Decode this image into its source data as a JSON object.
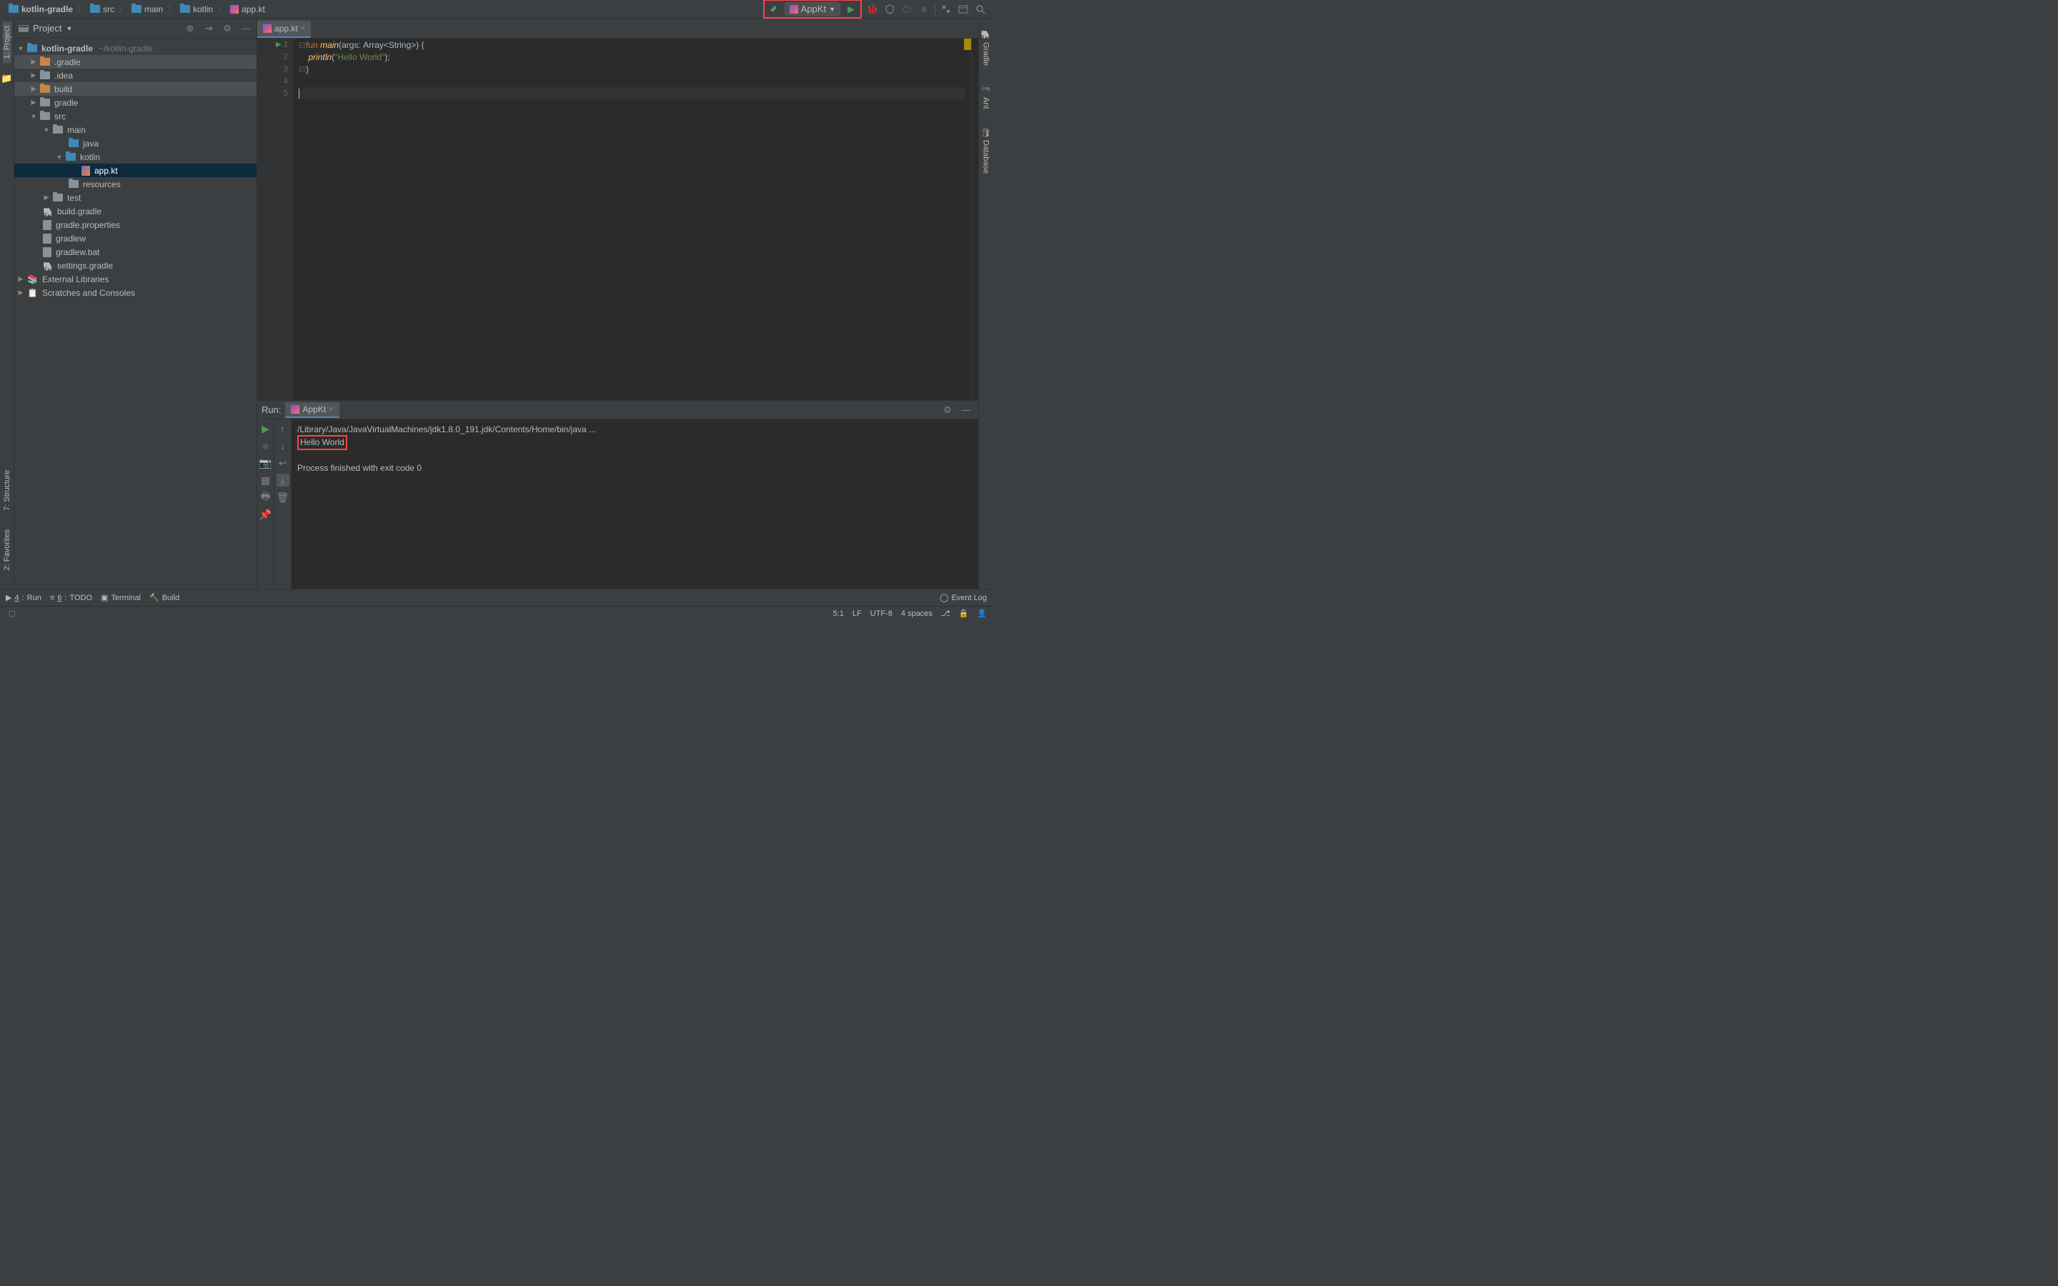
{
  "breadcrumb": {
    "items": [
      {
        "label": "kotlin-gradle",
        "icon": "folder-blue"
      },
      {
        "label": "src",
        "icon": "folder-blue"
      },
      {
        "label": "main",
        "icon": "folder-blue"
      },
      {
        "label": "kotlin",
        "icon": "folder-blue"
      },
      {
        "label": "app.kt",
        "icon": "kotlin"
      }
    ]
  },
  "run_config": {
    "label": "AppKt"
  },
  "sidebar": {
    "title": "Project",
    "root": {
      "label": "kotlin-gradle",
      "path": "~/kotlin-gradle"
    },
    "tree": {
      "gradle_dir": ".gradle",
      "idea_dir": ".idea",
      "build": "build",
      "gradle": "gradle",
      "src": "src",
      "main": "main",
      "java": "java",
      "kotlin": "kotlin",
      "app_kt": "app.kt",
      "resources": "resources",
      "test": "test",
      "build_gradle": "build.gradle",
      "gradle_properties": "gradle.properties",
      "gradlew": "gradlew",
      "gradlew_bat": "gradlew.bat",
      "settings_gradle": "settings.gradle",
      "external_libs": "External Libraries",
      "scratches": "Scratches and Consoles"
    }
  },
  "left_rail": {
    "project": "1: Project"
  },
  "left_rail_bottom": {
    "structure": "7: Structure",
    "favorites": "2: Favorites"
  },
  "right_rail": {
    "gradle": "Gradle",
    "ant": "Ant",
    "database": "Database"
  },
  "editor": {
    "tab_name": "app.kt",
    "lines": {
      "1": {
        "num": "1"
      },
      "2": {
        "num": "2"
      },
      "3": {
        "num": "3"
      },
      "4": {
        "num": "4"
      },
      "5": {
        "num": "5"
      }
    },
    "code": {
      "fun": "fun ",
      "main": "main",
      "args": "args",
      "array": "Array",
      "string": "String",
      "println": "println",
      "hello": "\"Hello World\""
    }
  },
  "run_panel": {
    "title": "Run:",
    "tab": "AppKt",
    "output": {
      "line1": "/Library/Java/JavaVirtualMachines/jdk1.8.0_191.jdk/Contents/Home/bin/java ...",
      "line2": "Hello World",
      "line4": "Process finished with exit code 0"
    }
  },
  "bottom_bar": {
    "run": "Run",
    "run_key": "4",
    "todo": "TODO",
    "todo_key": "6",
    "terminal": "Terminal",
    "build": "Build",
    "event_log": "Event Log"
  },
  "status_bar": {
    "position": "5:1",
    "line_sep": "LF",
    "encoding": "UTF-8",
    "indent": "4 spaces"
  }
}
